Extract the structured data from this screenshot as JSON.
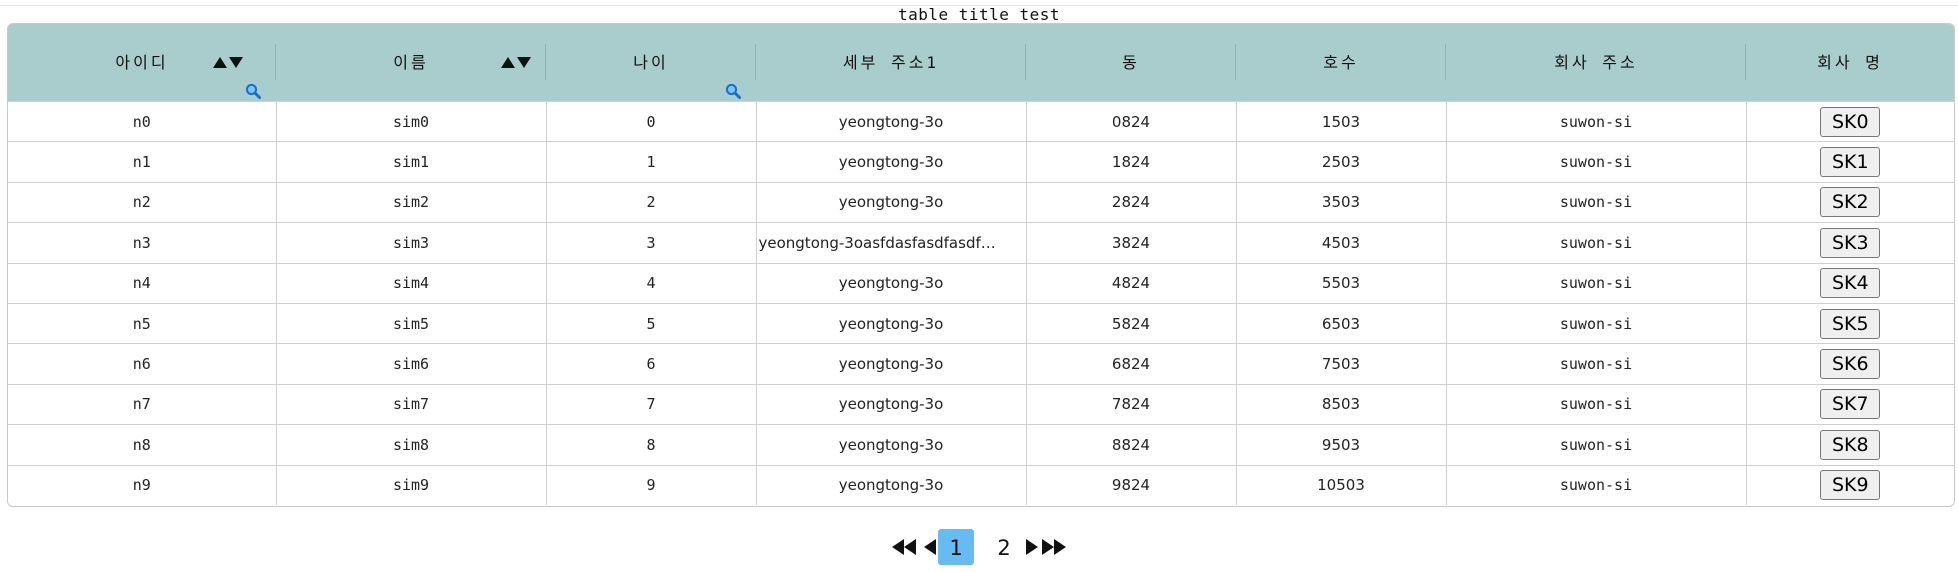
{
  "title": "table title test",
  "headers": [
    "아이디",
    "이름",
    "나이",
    "세부 주소1",
    "동",
    "호수",
    "회사 주소",
    "회사 명"
  ],
  "rows": [
    {
      "id": "n0",
      "name": "sim0",
      "age": "0",
      "addr": "yeongtong-3o",
      "dong": "0824",
      "ho": "1503",
      "company_addr": "suwon-si",
      "company": "SK0"
    },
    {
      "id": "n1",
      "name": "sim1",
      "age": "1",
      "addr": "yeongtong-3o",
      "dong": "1824",
      "ho": "2503",
      "company_addr": "suwon-si",
      "company": "SK1"
    },
    {
      "id": "n2",
      "name": "sim2",
      "age": "2",
      "addr": "yeongtong-3o",
      "dong": "2824",
      "ho": "3503",
      "company_addr": "suwon-si",
      "company": "SK2"
    },
    {
      "id": "n3",
      "name": "sim3",
      "age": "3",
      "addr": "yeongtong-3oasfdasfasdfasdf…",
      "dong": "3824",
      "ho": "4503",
      "company_addr": "suwon-si",
      "company": "SK3"
    },
    {
      "id": "n4",
      "name": "sim4",
      "age": "4",
      "addr": "yeongtong-3o",
      "dong": "4824",
      "ho": "5503",
      "company_addr": "suwon-si",
      "company": "SK4"
    },
    {
      "id": "n5",
      "name": "sim5",
      "age": "5",
      "addr": "yeongtong-3o",
      "dong": "5824",
      "ho": "6503",
      "company_addr": "suwon-si",
      "company": "SK5"
    },
    {
      "id": "n6",
      "name": "sim6",
      "age": "6",
      "addr": "yeongtong-3o",
      "dong": "6824",
      "ho": "7503",
      "company_addr": "suwon-si",
      "company": "SK6"
    },
    {
      "id": "n7",
      "name": "sim7",
      "age": "7",
      "addr": "yeongtong-3o",
      "dong": "7824",
      "ho": "8503",
      "company_addr": "suwon-si",
      "company": "SK7"
    },
    {
      "id": "n8",
      "name": "sim8",
      "age": "8",
      "addr": "yeongtong-3o",
      "dong": "8824",
      "ho": "9503",
      "company_addr": "suwon-si",
      "company": "SK8"
    },
    {
      "id": "n9",
      "name": "sim9",
      "age": "9",
      "addr": "yeongtong-3o",
      "dong": "9824",
      "ho": "10503",
      "company_addr": "suwon-si",
      "company": "SK9"
    }
  ],
  "pagination": {
    "pages": [
      "1",
      "2"
    ],
    "current": "1"
  },
  "icons": {
    "sort": "sort-arrows-icon",
    "search": "search-icon",
    "first": "first-page-icon",
    "prev": "prev-page-icon",
    "next": "next-page-icon",
    "last": "last-page-icon"
  },
  "colors": {
    "header_bg": "#a9cccc",
    "active_page": "#66bbf2",
    "search_icon": "#1e88e5"
  }
}
